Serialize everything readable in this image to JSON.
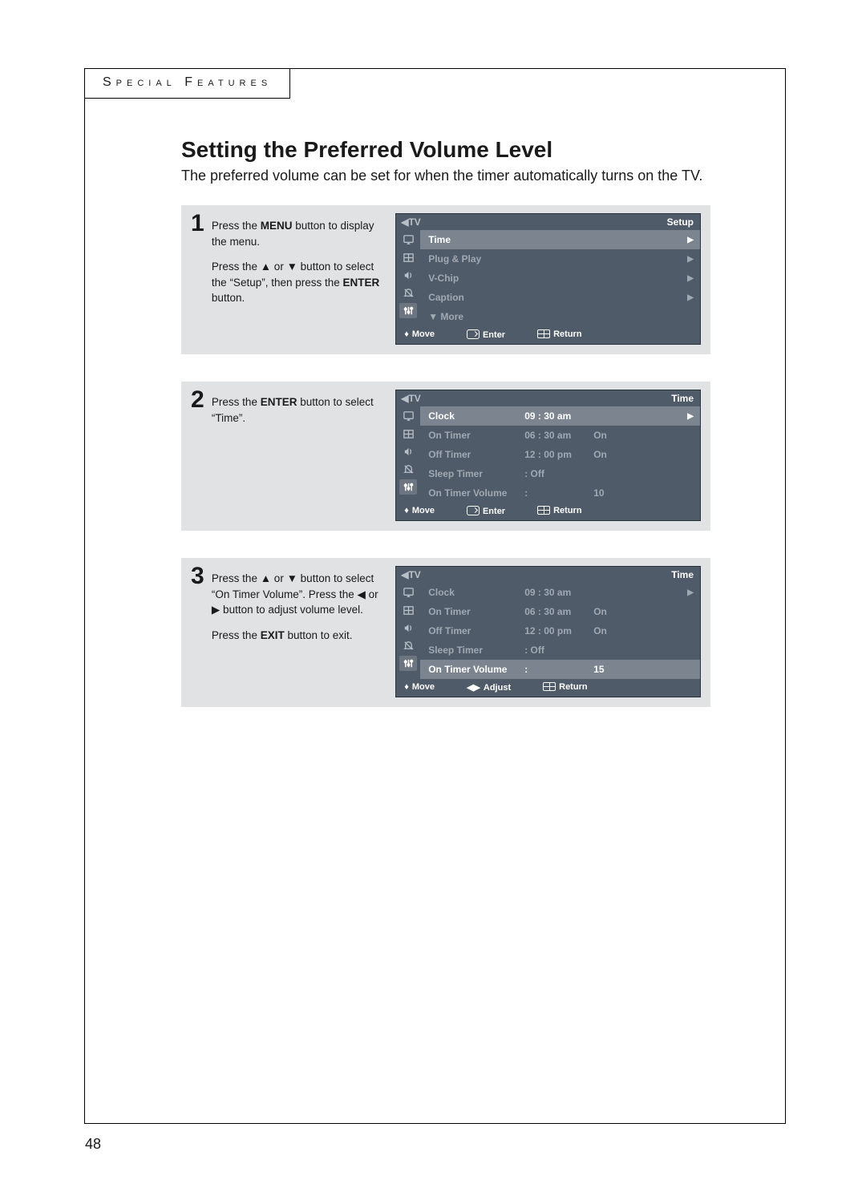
{
  "section_tab": "Special Features",
  "title": "Setting the Preferred Volume Level",
  "lead": "The preferred volume can be set for when the timer automatically turns on the TV.",
  "page_number": "48",
  "steps": [
    {
      "num": "1",
      "paras": [
        "Press the <b>MENU</b> button to display the menu.",
        "Press the ▲ or ▼ button to select the “Setup”, then press the <b>ENTER</b> button."
      ],
      "osd": {
        "title_left": "TV",
        "title_right": "Setup",
        "rows": [
          {
            "label": "Time",
            "val": "",
            "state": "",
            "arrow": "▶",
            "hl": true
          },
          {
            "label": "Plug & Play",
            "val": "",
            "state": "",
            "arrow": "▶",
            "hl": false
          },
          {
            "label": "V-Chip",
            "val": "",
            "state": "",
            "arrow": "▶",
            "hl": false
          },
          {
            "label": "Caption",
            "val": "",
            "state": "",
            "arrow": "▶",
            "hl": false
          },
          {
            "label": "▼ More",
            "val": "",
            "state": "",
            "arrow": "",
            "hl": false
          }
        ],
        "footer": [
          "Move",
          "Enter",
          "Return"
        ],
        "footer_middle_mode": "enter"
      }
    },
    {
      "num": "2",
      "paras": [
        "Press the <b>ENTER</b> button to select “Time”."
      ],
      "osd": {
        "title_left": "TV",
        "title_right": "Time",
        "rows": [
          {
            "label": "Clock",
            "val": "09 : 30 am",
            "state": "",
            "arrow": "▶",
            "hl": true
          },
          {
            "label": "On Timer",
            "val": "06 : 30 am",
            "state": "On",
            "arrow": "",
            "hl": false
          },
          {
            "label": "Off Timer",
            "val": "12 : 00 pm",
            "state": "On",
            "arrow": "",
            "hl": false
          },
          {
            "label": "Sleep Timer",
            "val": ": Off",
            "state": "",
            "arrow": "",
            "hl": false
          },
          {
            "label": "On Timer Volume",
            "val": ":",
            "state": "10",
            "arrow": "",
            "hl": false
          }
        ],
        "footer": [
          "Move",
          "Enter",
          "Return"
        ],
        "footer_middle_mode": "enter"
      }
    },
    {
      "num": "3",
      "paras": [
        "Press the ▲ or ▼ button to select “On Timer Volume”. Press the ◀ or ▶ button to adjust volume level.",
        "Press the <b>EXIT</b> button to exit."
      ],
      "osd": {
        "title_left": "TV",
        "title_right": "Time",
        "rows": [
          {
            "label": "Clock",
            "val": "09 : 30 am",
            "state": "",
            "arrow": "▶",
            "hl": false
          },
          {
            "label": "On Timer",
            "val": "06 : 30 am",
            "state": "On",
            "arrow": "",
            "hl": false
          },
          {
            "label": "Off Timer",
            "val": "12 : 00 pm",
            "state": "On",
            "arrow": "",
            "hl": false
          },
          {
            "label": "Sleep Timer",
            "val": ": Off",
            "state": "",
            "arrow": "",
            "hl": false
          },
          {
            "label": "On Timer Volume",
            "val": ":",
            "state": "15",
            "arrow": "",
            "hl": true
          }
        ],
        "footer": [
          "Move",
          "Adjust",
          "Return"
        ],
        "footer_middle_mode": "adjust"
      }
    }
  ]
}
